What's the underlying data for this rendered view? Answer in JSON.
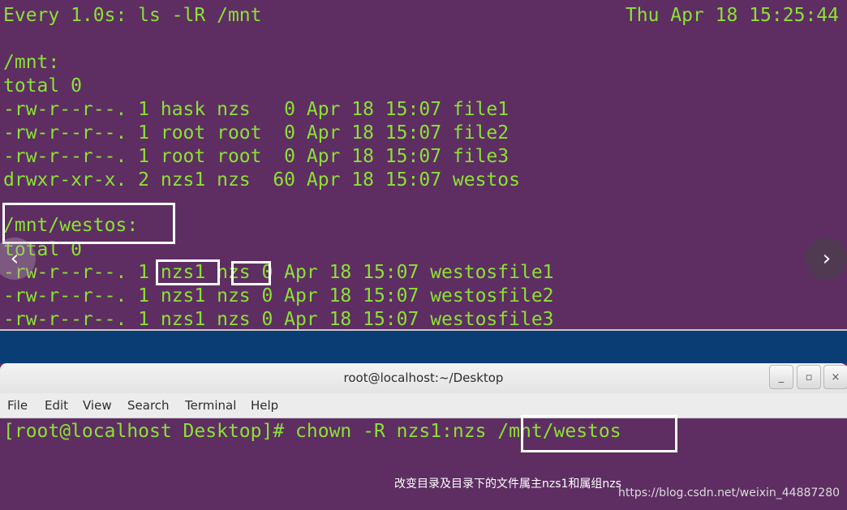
{
  "watch": {
    "header": "Every 1.0s: ls -lR /mnt",
    "date": "Thu Apr 18 15:25:44",
    "lines": [
      "/mnt:",
      "total 0",
      "-rw-r--r--. 1 hask nzs   0 Apr 18 15:07 file1",
      "-rw-r--r--. 1 root root  0 Apr 18 15:07 file2",
      "-rw-r--r--. 1 root root  0 Apr 18 15:07 file3",
      "drwxr-xr-x. 2 nzs1 nzs  60 Apr 18 15:07 westos",
      "",
      "/mnt/westos:",
      "total 0",
      "-rw-r--r--. 1 nzs1 nzs 0 Apr 18 15:07 westosfile1",
      "-rw-r--r--. 1 nzs1 nzs 0 Apr 18 15:07 westosfile2",
      "-rw-r--r--. 1 nzs1 nzs 0 Apr 18 15:07 westosfile3"
    ]
  },
  "carousel": {
    "prev_icon": "‹",
    "next_icon": "›"
  },
  "terminal": {
    "title": "root@localhost:~/Desktop",
    "buttons": {
      "minimize": "_",
      "maximize": "▫",
      "close": "×"
    },
    "menu": [
      "File",
      "Edit",
      "View",
      "Search",
      "Terminal",
      "Help"
    ],
    "prompt": "[root@localhost Desktop]# chown -R nzs1:nzs /mnt/westos"
  },
  "caption": "改变目录及目录下的文件属主nzs1和属组nzs",
  "watermark": "https://blog.csdn.net/weixin_44887280",
  "colors": {
    "terminal_bg": "#5e2e62",
    "terminal_text": "#8ae234",
    "desktop_bg": "#0a3d74",
    "annotation_box": "#ffffff"
  }
}
